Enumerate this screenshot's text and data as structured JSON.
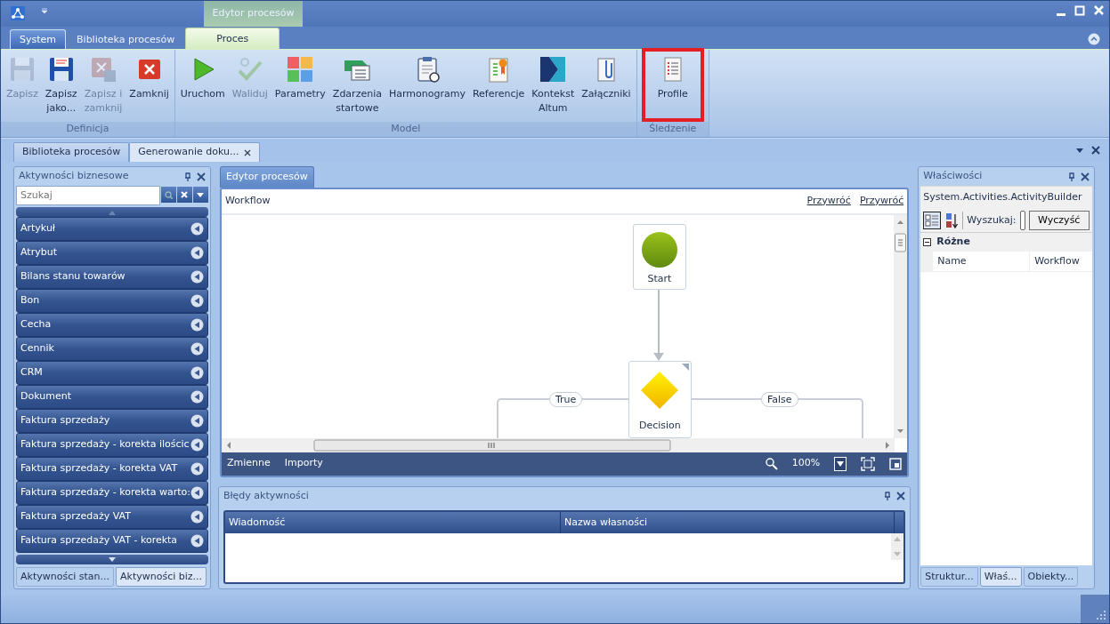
{
  "title_bar": {
    "context_group": "Edytor procesów"
  },
  "ribbon_tabs": [
    {
      "label": "System",
      "kind": "app",
      "selected": false
    },
    {
      "label": "Biblioteka procesów",
      "kind": "tab",
      "selected": false
    },
    {
      "label": "Proces",
      "kind": "tab",
      "selected": true
    }
  ],
  "ribbon_groups": [
    {
      "label": "Definicja",
      "buttons": [
        {
          "label": "Zapisz",
          "disabled": true,
          "highlighted": false
        },
        {
          "label": "Zapisz\njako...",
          "disabled": false,
          "highlighted": false
        },
        {
          "label": "Zapisz i\nzamknij",
          "disabled": true,
          "highlighted": false
        },
        {
          "label": "Zamknij",
          "disabled": false,
          "highlighted": false
        }
      ]
    },
    {
      "label": "Model",
      "buttons": [
        {
          "label": "Uruchom",
          "disabled": false,
          "highlighted": false
        },
        {
          "label": "Waliduj",
          "disabled": true,
          "highlighted": false
        },
        {
          "label": "Parametry",
          "disabled": false,
          "highlighted": false
        },
        {
          "label": "Zdarzenia\nstartowe",
          "disabled": false,
          "highlighted": false
        },
        {
          "label": "Harmonogramy",
          "disabled": false,
          "highlighted": false
        },
        {
          "label": "Referencje",
          "disabled": false,
          "highlighted": false
        },
        {
          "label": "Kontekst\nAltum",
          "disabled": false,
          "highlighted": false
        },
        {
          "label": "Załączniki",
          "disabled": false,
          "highlighted": false
        }
      ]
    },
    {
      "label": "Śledzenie",
      "buttons": [
        {
          "label": "Profile",
          "disabled": false,
          "highlighted": true
        }
      ]
    }
  ],
  "document_tabs": [
    {
      "label": "Biblioteka procesów",
      "selected": false,
      "closable": false
    },
    {
      "label": "Generowanie doku...",
      "selected": true,
      "closable": true
    }
  ],
  "activities_panel": {
    "title": "Aktywności biznesowe",
    "search": {
      "placeholder": "Szukaj"
    },
    "items": [
      "Artykuł",
      "Atrybut",
      "Bilans stanu towarów",
      "Bon",
      "Cecha",
      "Cennik",
      "CRM",
      "Dokument",
      "Faktura sprzedaży",
      "Faktura sprzedaży - korekta ilościc",
      "Faktura sprzedaży - korekta VAT",
      "Faktura sprzedaży - korekta warto:",
      "Faktura sprzedaży VAT",
      "Faktura sprzedaży VAT - korekta"
    ],
    "tabs": [
      {
        "label": "Aktywności stan...",
        "selected": false
      },
      {
        "label": "Aktywności biz...",
        "selected": true
      }
    ]
  },
  "editor": {
    "tab": "Edytor procesów",
    "breadcrumb": "Workflow",
    "links": [
      "Przywróć",
      "Przywróć"
    ],
    "nodes": [
      {
        "kind": "start",
        "label": "Start"
      },
      {
        "kind": "decision",
        "label": "Decision"
      }
    ],
    "branches": [
      "True",
      "False"
    ],
    "footer_tabs": [
      "Zmienne",
      "Importy"
    ],
    "zoom": "100%"
  },
  "errors_panel": {
    "title": "Błędy aktywności",
    "columns": [
      "Wiadomość",
      "Nazwa własności"
    ]
  },
  "properties_panel": {
    "title": "Właściwości",
    "object_type": "System.Activities.ActivityBuilder",
    "search_label": "Wyszukaj:",
    "clear_button": "Wyczyść",
    "categories": [
      {
        "label": "Różne",
        "expanded": true,
        "rows": [
          {
            "name": "Name",
            "value": "Workflow"
          }
        ]
      }
    ],
    "tabs": [
      {
        "label": "Struktur...",
        "selected": false
      },
      {
        "label": "Właś...",
        "selected": true
      },
      {
        "label": "Obiekty...",
        "selected": false
      }
    ]
  }
}
